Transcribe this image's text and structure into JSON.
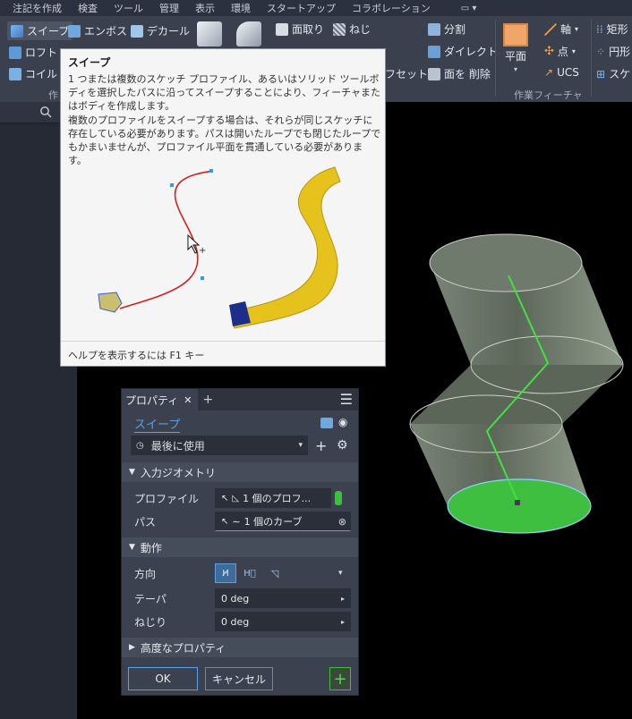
{
  "menu": [
    "注記を作成",
    "検査",
    "ツール",
    "管理",
    "表示",
    "環境",
    "スタートアップ",
    "コラボレーション"
  ],
  "ribbon": {
    "sweep": "スイープ",
    "emboss": "エンボス",
    "decal": "デカール",
    "loft": "ロフト",
    "coil": "コイル",
    "fillet": "面取り",
    "thread": "ねじ",
    "split": "分割",
    "direct": "ダイレクト",
    "offset": "フセット",
    "delete_face": "面を 削除",
    "plane": "平面",
    "axis": "軸",
    "point": "点",
    "ucs": "UCS",
    "work_features_panel": "作業フィーチャ",
    "rect": "矩形",
    "circle": "円形",
    "sketch": "スケ",
    "create_panel": "作"
  },
  "tooltip": {
    "title": "スイープ",
    "para1": "1 つまたは複数のスケッチ プロファイル、あるいはソリッド ツールボディを選択したパスに沿ってスイープすることにより、フィーチャまたはボディを作成します。",
    "para2": "複数のプロファイルをスイープする場合は、それらが同じスケッチに存在している必要があります。パスは開いたループでも閉じたループでもかまいませんが、プロファイル平面を貫通している必要があります。",
    "footer": "ヘルプを表示するには F1 キー"
  },
  "properties": {
    "tab_label": "プロパティ",
    "feature_name": "スイープ",
    "preset": "最後に使用",
    "section_input": "入力ジオメトリ",
    "profile_label": "プロファイル",
    "profile_value": "1 個のプロフ...",
    "path_label": "パス",
    "path_value": "1 個のカーブ",
    "section_behavior": "動作",
    "direction_label": "方向",
    "taper_label": "テーパ",
    "taper_value": "0 deg",
    "twist_label": "ねじり",
    "twist_value": "0 deg",
    "section_advanced": "高度なプロパティ",
    "ok": "OK",
    "cancel": "キャンセル"
  },
  "colors": {
    "accent_blue": "#5aa0e6",
    "model_green": "#3fbf3f",
    "path_green": "#43e043",
    "sweep_yellow": "#e6c21c"
  }
}
